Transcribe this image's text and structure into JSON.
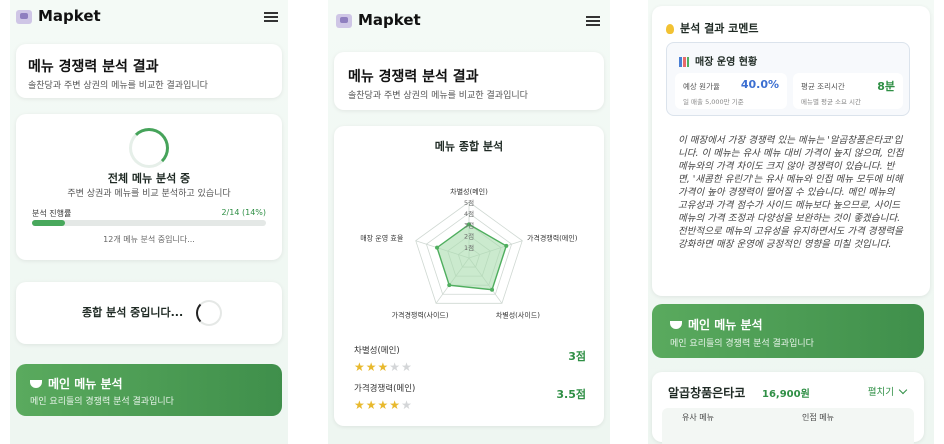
{
  "brand": "Mapket",
  "header": {
    "title": "메뉴 경쟁력 분석 결과",
    "subtitle": "솔찬당과 주변 상권의 메뉴를 비교한 결과입니다"
  },
  "loading": {
    "title": "전체 메뉴 분석 중",
    "subtitle": "주변 상권과 메뉴를 비교 분석하고 있습니다",
    "progress_label": "분석 진행률",
    "progress_text": "2/14 (14%)",
    "progress_value": 0.14,
    "status": "12개 메뉴 분석 중입니다..."
  },
  "overall": {
    "label": "종합 분석 중입니다..."
  },
  "main_menu": {
    "title": "메인 메뉴 분석",
    "subtitle": "메인 요리들의 경쟁력 분석 결과입니다"
  },
  "radar": {
    "title": "메뉴 종합 분석",
    "axes": [
      "차별성(메인)",
      "가격경쟁력(메인)",
      "차별성(사이드)",
      "가격경쟁력(사이드)",
      "매장 운영 효율"
    ],
    "scale_labels": [
      "5점",
      "4점",
      "3점",
      "2점",
      "1점"
    ],
    "colors": {
      "fill": "#a9dcae",
      "stroke": "#4fae5e",
      "grid": "#cfd8d2"
    }
  },
  "chart_data": {
    "type": "radar",
    "title": "메뉴 종합 분석",
    "categories": [
      "차별성(메인)",
      "가격경쟁력(메인)",
      "차별성(사이드)",
      "가격경쟁력(사이드)",
      "매장 운영 효율"
    ],
    "values": [
      3,
      3.5,
      3.5,
      3,
      3
    ],
    "rlim": [
      0,
      5
    ]
  },
  "scores": [
    {
      "label": "차별성(메인)",
      "score_text": "3점",
      "stars": 3
    },
    {
      "label": "가격경쟁력(메인)",
      "score_text": "3.5점",
      "stars": 3.5
    }
  ],
  "comment": {
    "title": "분석 결과 코멘트",
    "ops_title": "매장 운영 현황",
    "cost_label": "예상 원가율",
    "cost_value": "40.0%",
    "cost_note": "일 매출 5,000만 기준",
    "time_label": "평균 조리시간",
    "time_value": "8분",
    "time_note": "메뉴별 평균 소요 시간",
    "text": "이 매장에서 가장 경쟁력 있는 메뉴는 '알곱창품은타코'입니다. 이 메뉴는 유사 메뉴 대비 가격이 높지 않으며, 인접 메뉴와의 가격 차이도 크지 않아 경쟁력이 있습니다. 반면, '새콤한 유린기'는 유사 메뉴와 인접 메뉴 모두에 비해 가격이 높아 경쟁력이 떨어질 수 있습니다. 메인 메뉴의 고유성과 가격 점수가 사이드 메뉴보다 높으므로, 사이드 메뉴의 가격 조정과 다양성을 보완하는 것이 좋겠습니다. 전반적으로 메뉴의 고유성을 유지하면서도 가격 경쟁력을 강화하면 매장 운영에 긍정적인 영향을 미칠 것입니다."
  },
  "menu_item": {
    "name": "알곱창품은타코",
    "price": "16,900원",
    "expand_label": "펼치기",
    "col_similar": "유사 메뉴",
    "col_adjacent": "인접 메뉴"
  },
  "colors": {
    "accent": "#46a35a",
    "blue": "#3c6fd1",
    "star": "#e8b92e"
  }
}
